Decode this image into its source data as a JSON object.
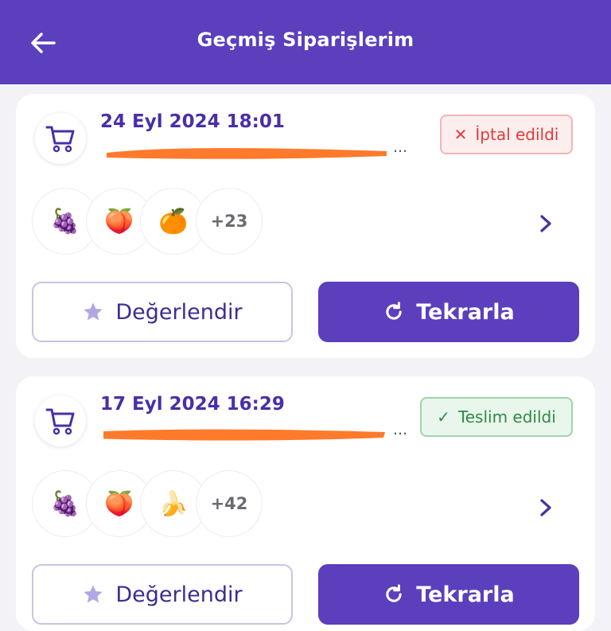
{
  "header": {
    "title": "Geçmiş Siparişlerim",
    "back_icon": "arrow-left-icon"
  },
  "colors": {
    "brand": "#5b3fbd",
    "cancel": "#e03b3b",
    "done": "#2f8a45"
  },
  "orders": [
    {
      "date": "24 Eyl 2024 18:01",
      "address_tail": "...",
      "status": "İptal edildi",
      "status_type": "cancelled",
      "items": [
        "🍇",
        "🍑",
        "🍊"
      ],
      "more_count": "+23",
      "rate_label": "Değerlendir",
      "repeat_label": "Tekrarla"
    },
    {
      "date": "17 Eyl 2024 16:29",
      "address_tail": "...",
      "status": "Teslim edildi",
      "status_type": "delivered",
      "items": [
        "🍇",
        "🍑",
        "🍌"
      ],
      "more_count": "+42",
      "rate_label": "Değerlendir",
      "repeat_label": "Tekrarla"
    }
  ]
}
